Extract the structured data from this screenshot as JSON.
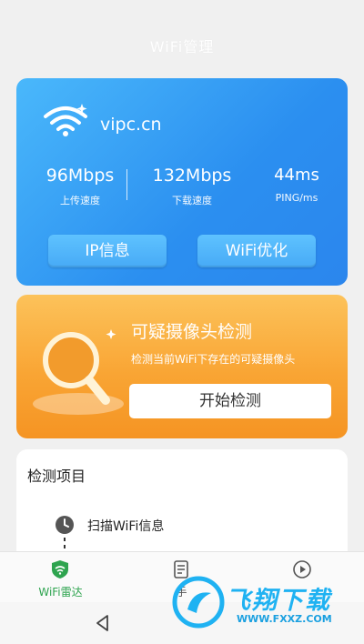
{
  "header": {
    "title": "WiFi管理"
  },
  "wifi_card": {
    "ssid": "vipc.cn",
    "stats": [
      {
        "value": "96Mbps",
        "label": "上传速度"
      },
      {
        "value": "132Mbps",
        "label": "下载速度"
      },
      {
        "value": "44ms",
        "label": "PING/ms"
      }
    ],
    "buttons": {
      "ip": "IP信息",
      "wifi": "WiFi优化"
    }
  },
  "camera_card": {
    "title": "可疑摄像头检测",
    "description": "检测当前WiFi下存在的可疑摄像头",
    "button": "开始检测"
  },
  "detect": {
    "title": "检测项目",
    "items": [
      {
        "label": "扫描WiFi信息"
      }
    ]
  },
  "tabs": [
    {
      "label": "WiFi雷达",
      "icon": "shield-wifi-icon",
      "active": true
    },
    {
      "label": "手",
      "icon": "document-icon",
      "active": false
    },
    {
      "label": "",
      "icon": "play-circle-icon",
      "active": false
    }
  ],
  "watermark": {
    "brand": "飞翔下载",
    "url": "WWW.FXXZ.COM"
  },
  "colors": {
    "blue_card": "#2b8ff0",
    "orange_card": "#f9a534",
    "active_tab": "#2ea44f",
    "watermark": "#1fb2f2"
  }
}
